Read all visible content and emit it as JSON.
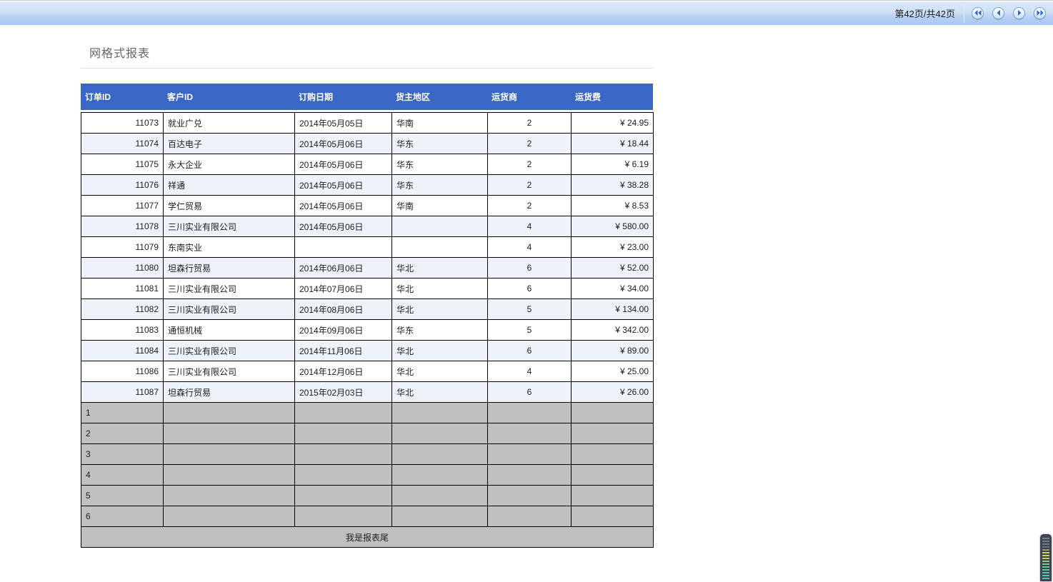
{
  "toolbar": {
    "page_indicator": "第42页/共42页",
    "nav_buttons": [
      {
        "id": "first-page",
        "icon": "double-left-arrow-icon",
        "title": "首页"
      },
      {
        "id": "prev-page",
        "icon": "left-arrow-icon",
        "title": "上一页"
      },
      {
        "id": "next-page",
        "icon": "right-arrow-icon",
        "title": "下一页"
      },
      {
        "id": "last-page",
        "icon": "double-right-arrow-icon",
        "title": "末页"
      }
    ]
  },
  "report": {
    "title": "网格式报表",
    "footer": "我是报表尾"
  },
  "table": {
    "headers": [
      "订单ID",
      "客户ID",
      "订购日期",
      "货主地区",
      "运货商",
      "运货费"
    ],
    "column_aligns": [
      "right",
      "left",
      "left",
      "left",
      "center",
      "right"
    ],
    "rows": [
      [
        "11073",
        "就业广兑",
        "2014年05月05日",
        "华南",
        "2",
        "¥ 24.95"
      ],
      [
        "11074",
        "百达电子",
        "2014年05月06日",
        "华东",
        "2",
        "¥ 18.44"
      ],
      [
        "11075",
        "永大企业",
        "2014年05月06日",
        "华东",
        "2",
        "¥ 6.19"
      ],
      [
        "11076",
        "祥通",
        "2014年05月06日",
        "华东",
        "2",
        "¥ 38.28"
      ],
      [
        "11077",
        "学仁贸易",
        "2014年05月06日",
        "华南",
        "2",
        "¥ 8.53"
      ],
      [
        "11078",
        "三川实业有限公司",
        "2014年05月06日",
        "",
        "4",
        "¥ 580.00"
      ],
      [
        "11079",
        "东南实业",
        "",
        "",
        "4",
        "¥ 23.00"
      ],
      [
        "11080",
        "坦森行贸易",
        "2014年06月06日",
        "华北",
        "6",
        "¥ 52.00"
      ],
      [
        "11081",
        "三川实业有限公司",
        "2014年07月06日",
        "华北",
        "6",
        "¥ 34.00"
      ],
      [
        "11082",
        "三川实业有限公司",
        "2014年08月06日",
        "华北",
        "5",
        "¥ 134.00"
      ],
      [
        "11083",
        "通恒机械",
        "2014年09月06日",
        "华东",
        "5",
        "¥ 342.00"
      ],
      [
        "11084",
        "三川实业有限公司",
        "2014年11月06日",
        "华北",
        "6",
        "¥ 89.00"
      ],
      [
        "11086",
        "三川实业有限公司",
        "2014年12月06日",
        "华北",
        "4",
        "¥ 25.00"
      ],
      [
        "11087",
        "坦森行贸易",
        "2015年02月03日",
        "华北",
        "6",
        "¥ 26.00"
      ]
    ],
    "filler_rows": [
      "1",
      "2",
      "3",
      "4",
      "5",
      "6"
    ]
  },
  "colors": {
    "header_bg": "#3a67c6",
    "alt_row_bg": "#eef2f9",
    "filler_bg": "#c0c0c0",
    "toolbar_top": "#d9e7f9",
    "toolbar_bottom": "#a8c7ef",
    "nav_arrow": "#2b66c9"
  }
}
